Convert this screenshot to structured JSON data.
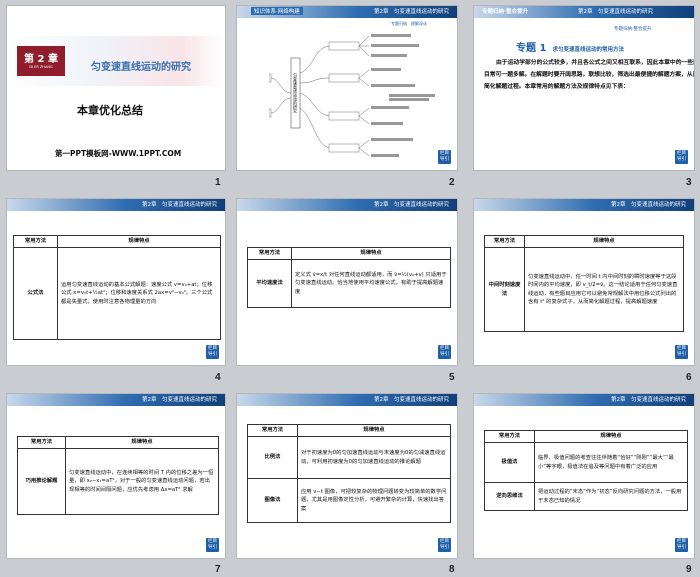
{
  "header_text": "第2章　匀变速直线运动的研究",
  "badge_text": "栏目导引",
  "slide1": {
    "number": "1",
    "chapter_label": "第 2 章",
    "chapter_sub": "DI ER ZHANG",
    "title": "匀变速直线运动的研究",
    "subtitle": "本章优化总结",
    "footer": "第一PPT模板网-WWW.1PPT.COM"
  },
  "slide2": {
    "number": "2",
    "tab": "知识体系·网络构建",
    "right_tabs": "第2章　匀变速直线运动的研究",
    "sub_tabs": "专题归纳　理解深化",
    "center_node": "匀变速直线运动的研究"
  },
  "slide3": {
    "number": "3",
    "tab": "专题归纳·整合提升",
    "right_tab": "第2章　匀变速直线运动的研究",
    "sub_right": "专题归纳·整合提升",
    "heading_num": "专题 1",
    "heading_text": "求匀变速直线运动的常用方法",
    "paragraph": "由于运动学部分的公式较多，并且各公式之间又相互联系，因此本章中的一些题目常可一题多解。在解题时要开阔思路，联想比较，筛选出最便捷的解题方案，从而简化解题过程。本章常用的解题方法及规律特点见下表："
  },
  "table_headers": {
    "method": "常用方法",
    "feature": "规律特点"
  },
  "slide4": {
    "number": "4",
    "method": "公式法",
    "feature": "运用匀变速直线运动的基本公式解题：速度公式 v=v₀+at；位移公式 x=v₀t+½at²；位移和速度关系式 2ax=v²−v₀²。三个公式都是矢量式，使用时注意各物理量的方向"
  },
  "slide5": {
    "number": "5",
    "method": "平均速度法",
    "feature": "定义式 v̄=x/t 对任何直线运动都适用，而 v̄=½(v₀+v) 只适用于匀变速直线运动。恰当地使用平均速度公式，有助于提高解题速度"
  },
  "slide6": {
    "number": "6",
    "method": "中间时刻速度法",
    "feature": "匀变速直线运动中，任一时间 t 内中间时刻的瞬时速度等于这段时间内的平均速度，即 v_t/2=v̄。这一结论适用于任何匀变速直线运动，有些题目应用它可以避免常规解法中用位移公式列出的含有 t² 的复杂式子，从而简化解题过程，提高解题速度"
  },
  "slide7": {
    "number": "7",
    "method": "巧用推论解题",
    "feature": "匀变速直线运动中，在连续相等的时间 T 内的位移之差为一恒量，即 x₂−x₁=aT²，对于一般的匀变速直线运动问题，若出现相等的时间间隔问题，应优先考虑用 Δx=aT² 求解"
  },
  "slide8": {
    "number": "8",
    "rows": [
      {
        "method": "比例法",
        "feature": "对于初速度为0的匀加速直线运动与末速度为0的匀减速直线运动，可利用初速度为0的匀加速直线运动的推论解题"
      },
      {
        "method": "图像法",
        "feature": "应用 v−t 图像，可把较复杂的物理问题转变为较简单的数学问题，尤其是用图像定性分析，可避开繁杂的计算，快速找出答案"
      }
    ]
  },
  "slide9": {
    "number": "9",
    "rows": [
      {
        "method": "极值法",
        "feature": "临界、极值问题的考查往往伴随着“恰好”“刚刚”“最大”“最小”等字眼，极值法在追及等问题中有着广泛的应用"
      },
      {
        "method": "逆向思维法",
        "feature": "把运动过程的“末态”作为“初态”反向研究问题的方法，一般用于末态已知的情况"
      }
    ]
  }
}
